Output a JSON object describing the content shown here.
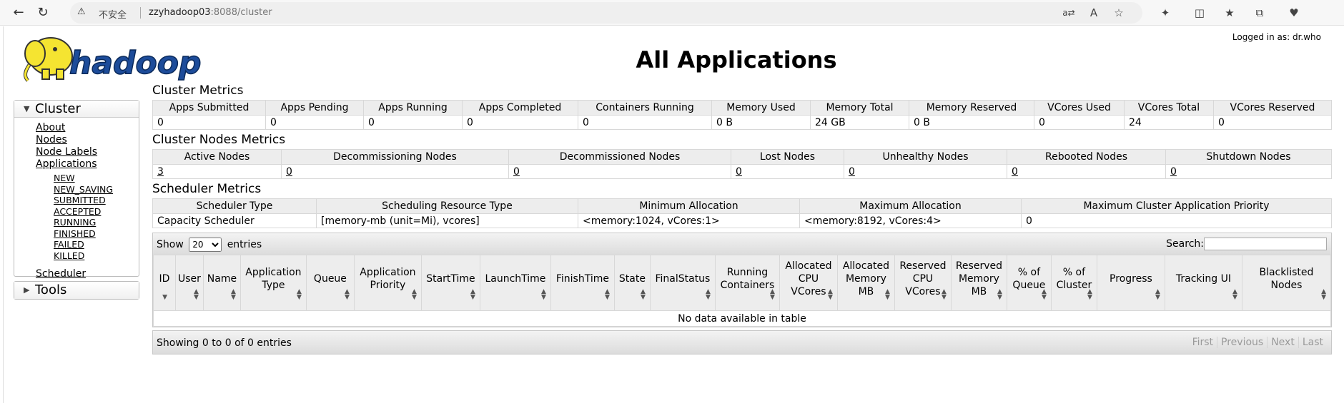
{
  "browser": {
    "security_label": "不安全",
    "url_host": "zzyhadoop03",
    "url_rest": ":8088/cluster"
  },
  "header": {
    "logo_text": "hadoop",
    "title": "All Applications",
    "logged_in": "Logged in as: dr.who"
  },
  "sidebar": {
    "cluster_label": "Cluster",
    "links": [
      "About",
      "Nodes",
      "Node Labels",
      "Applications"
    ],
    "states": [
      "NEW",
      "NEW_SAVING",
      "SUBMITTED",
      "ACCEPTED",
      "RUNNING",
      "FINISHED",
      "FAILED",
      "KILLED"
    ],
    "scheduler": "Scheduler",
    "tools_label": "Tools"
  },
  "cluster_metrics": {
    "heading": "Cluster Metrics",
    "headers": [
      "Apps Submitted",
      "Apps Pending",
      "Apps Running",
      "Apps Completed",
      "Containers Running",
      "Memory Used",
      "Memory Total",
      "Memory Reserved",
      "VCores Used",
      "VCores Total",
      "VCores Reserved"
    ],
    "values": [
      "0",
      "0",
      "0",
      "0",
      "0",
      "0 B",
      "24 GB",
      "0 B",
      "0",
      "24",
      "0"
    ]
  },
  "node_metrics": {
    "heading": "Cluster Nodes Metrics",
    "headers": [
      "Active Nodes",
      "Decommissioning Nodes",
      "Decommissioned Nodes",
      "Lost Nodes",
      "Unhealthy Nodes",
      "Rebooted Nodes",
      "Shutdown Nodes"
    ],
    "values": [
      "3",
      "0",
      "0",
      "0",
      "0",
      "0",
      "0"
    ]
  },
  "scheduler_metrics": {
    "heading": "Scheduler Metrics",
    "headers": [
      "Scheduler Type",
      "Scheduling Resource Type",
      "Minimum Allocation",
      "Maximum Allocation",
      "Maximum Cluster Application Priority"
    ],
    "values": [
      "Capacity Scheduler",
      "[memory-mb (unit=Mi), vcores]",
      "<memory:1024, vCores:1>",
      "<memory:8192, vCores:4>",
      "0"
    ]
  },
  "apps_table": {
    "show_label": "Show",
    "entries_label": "entries",
    "page_size": "20",
    "search_label": "Search:",
    "columns": [
      "ID",
      "User",
      "Name",
      "Application Type",
      "Queue",
      "Application Priority",
      "StartTime",
      "LaunchTime",
      "FinishTime",
      "State",
      "FinalStatus",
      "Running Containers",
      "Allocated CPU VCores",
      "Allocated Memory MB",
      "Reserved CPU VCores",
      "Reserved Memory MB",
      "% of Queue",
      "% of Cluster",
      "Progress",
      "Tracking UI",
      "Blacklisted Nodes"
    ],
    "empty_text": "No data available in table",
    "info_text": "Showing 0 to 0 of 0 entries",
    "pager": [
      "First",
      "Previous",
      "Next",
      "Last"
    ]
  }
}
